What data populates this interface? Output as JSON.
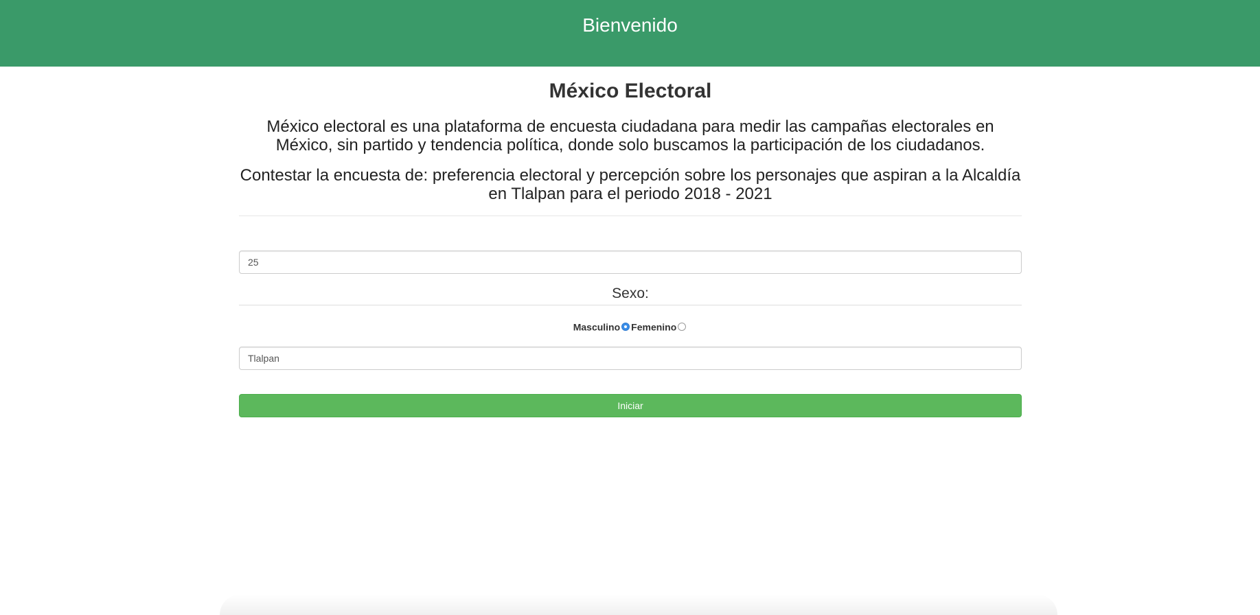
{
  "header": {
    "title": "Bienvenido"
  },
  "main": {
    "title": "México Electoral",
    "intro": "México electoral es una plataforma de encuesta ciudadana para medir las campañas electorales en México, sin partido y tendencia política, donde solo buscamos la participación de los ciudadanos.",
    "survey_text": "Contestar la encuesta de: preferencia electoral y percepción sobre los personajes que aspiran a la Alcaldía en Tlalpan para el periodo 2018 - 2021"
  },
  "form": {
    "age_value": "25",
    "sex_label": "Sexo:",
    "sex_options": [
      {
        "label": "Masculino",
        "selected": true
      },
      {
        "label": "Femenino",
        "selected": false
      }
    ],
    "alcaldia_value": "Tlalpan",
    "submit_label": "Iniciar"
  },
  "colors": {
    "header_bg": "#3a9a69",
    "button_bg": "#5cb85c",
    "radio_selected": "#3b8ee8"
  }
}
